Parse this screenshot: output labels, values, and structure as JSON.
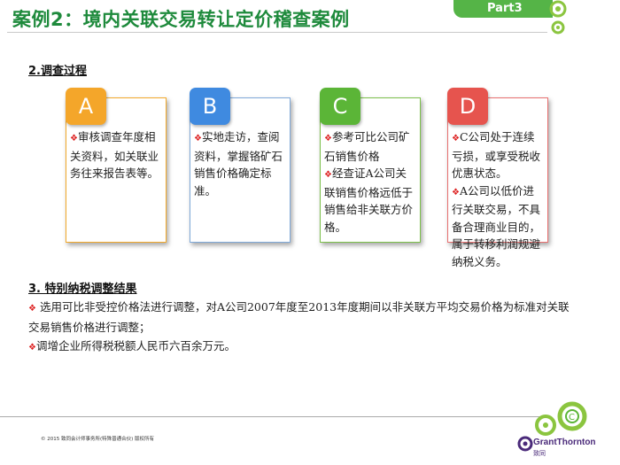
{
  "header": {
    "title": "案例2：境内关联交易转让定价稽查案例",
    "part_label": "Part3"
  },
  "section2": {
    "heading": "2.调查过程"
  },
  "cards": [
    {
      "letter": "A",
      "lines": [
        "审核调查年度相关资料，如关联业务往来报告表等。"
      ]
    },
    {
      "letter": "B",
      "lines": [
        "实地走访，查阅资料，掌握铬矿石销售价格确定标准。"
      ]
    },
    {
      "letter": "C",
      "lines": [
        "参考可比公司矿石销售价格",
        "经查证A公司关联销售价格远低于销售给非关联方价格。"
      ]
    },
    {
      "letter": "D",
      "lines": [
        "C公司处于连续亏损，或享受税收优惠状态。",
        "A公司以低价进行关联交易，不具备合理商业目的，属于转移利润规避纳税义务。"
      ]
    }
  ],
  "section3": {
    "heading": "3. 特别纳税调整结果",
    "bullets": [
      "选用可比非受控价格法进行调整，对A公司2007年度至2013年度期间以非关联方平均交易价格为标准对关联交易销售价格进行调整；",
      "调增企业所得税税额人民币六百余万元。"
    ]
  },
  "footer": {
    "copyright": "© 2015 致同会计师事务所(特殊普通合伙) 版权所有",
    "brand": "GrantThornton",
    "brand_cn": "致同"
  },
  "colors": {
    "title_green": "#1e8a3c",
    "A": "#f4a62a",
    "B": "#3f8ae0",
    "C": "#5bb537",
    "D": "#e6544e"
  }
}
